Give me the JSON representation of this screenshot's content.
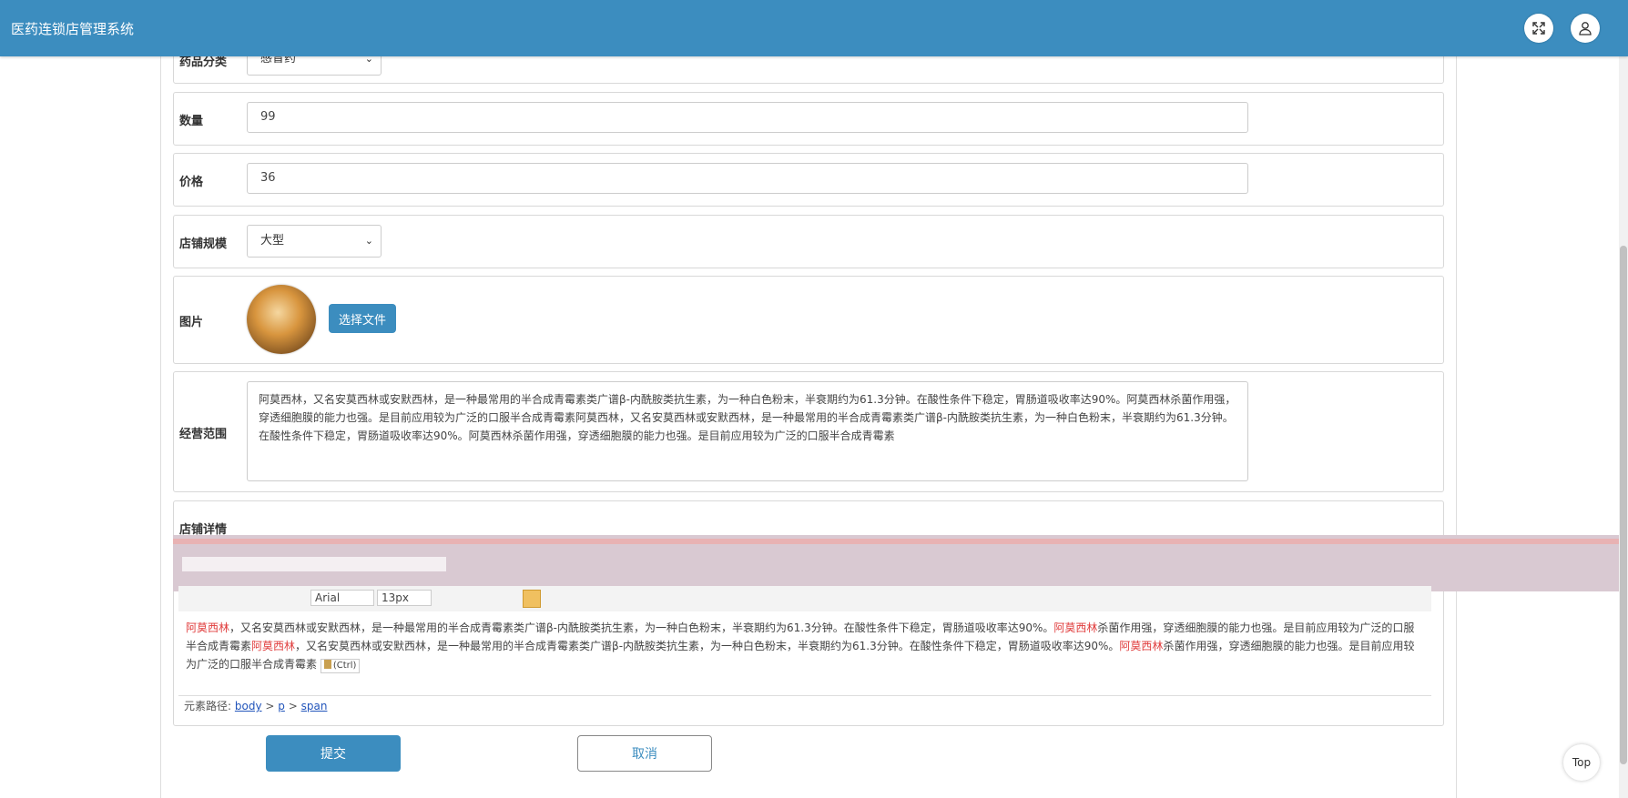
{
  "app": {
    "title": "医药连锁店管理系统"
  },
  "header_icons": {
    "fullscreen": "fullscreen-icon",
    "user": "user-icon"
  },
  "form": {
    "category": {
      "label": "药品分类",
      "value": "感冒药"
    },
    "quantity": {
      "label": "数量",
      "value": "99"
    },
    "price": {
      "label": "价格",
      "value": "36"
    },
    "store_size": {
      "label": "店铺规模",
      "value": "大型"
    },
    "image": {
      "label": "图片",
      "choose_file": "选择文件"
    },
    "business_scope": {
      "label": "经营范围",
      "value": "阿莫西林，又名安莫西林或安默西林，是一种最常用的半合成青霉素类广谱β-内酰胺类抗生素，为一种白色粉末，半衰期约为61.3分钟。在酸性条件下稳定，胃肠道吸收率达90%。阿莫西林杀菌作用强，穿透细胞膜的能力也强。是目前应用较为广泛的口服半合成青霉素阿莫西林，又名安莫西林或安默西林，是一种最常用的半合成青霉素类广谱β-内酰胺类抗生素，为一种白色粉末，半衰期约为61.3分钟。在酸性条件下稳定，胃肠道吸收率达90%。阿莫西林杀菌作用强，穿透细胞膜的能力也强。是目前应用较为广泛的口服半合成青霉素"
    },
    "store_details": {
      "label": "店铺详情"
    }
  },
  "editor": {
    "toolbar": {
      "font_family": "Arial",
      "font_size": "13px"
    },
    "content": {
      "seg1": "阿莫西林",
      "seg2": "，又名安莫西林或安默西林，是一种最常用的半合成青霉素类广谱β-内酰胺类抗生素，为一种白色粉末，半衰期约为61.3分钟。在酸性条件下稳定，胃肠道吸收率达90%。",
      "seg3": "阿莫西林",
      "seg4": "杀菌作用强，穿透细胞膜的能力也强。是目前应用较为广泛的口服半合成青霉素",
      "seg5": "阿莫西林",
      "seg6": "，又名安莫西林或安默西林，是一种最常用的半合成青霉素类广谱β-内酰胺类抗生素，为一种白色粉末，半衰期约为61.3分钟。在酸性条件下稳定，胃肠道吸收率达90%。",
      "seg7": "阿莫西林",
      "seg8": "杀菌作用强，穿透细胞膜的能力也强。是目前应用较为广泛的口服半合成青霉素"
    },
    "paste_badge": "(Ctrl)",
    "path": {
      "label": "元素路径:",
      "sep": ">",
      "items": [
        "body",
        "p",
        "span"
      ]
    }
  },
  "actions": {
    "submit": "提交",
    "cancel": "取消"
  },
  "top_button": "Top"
}
